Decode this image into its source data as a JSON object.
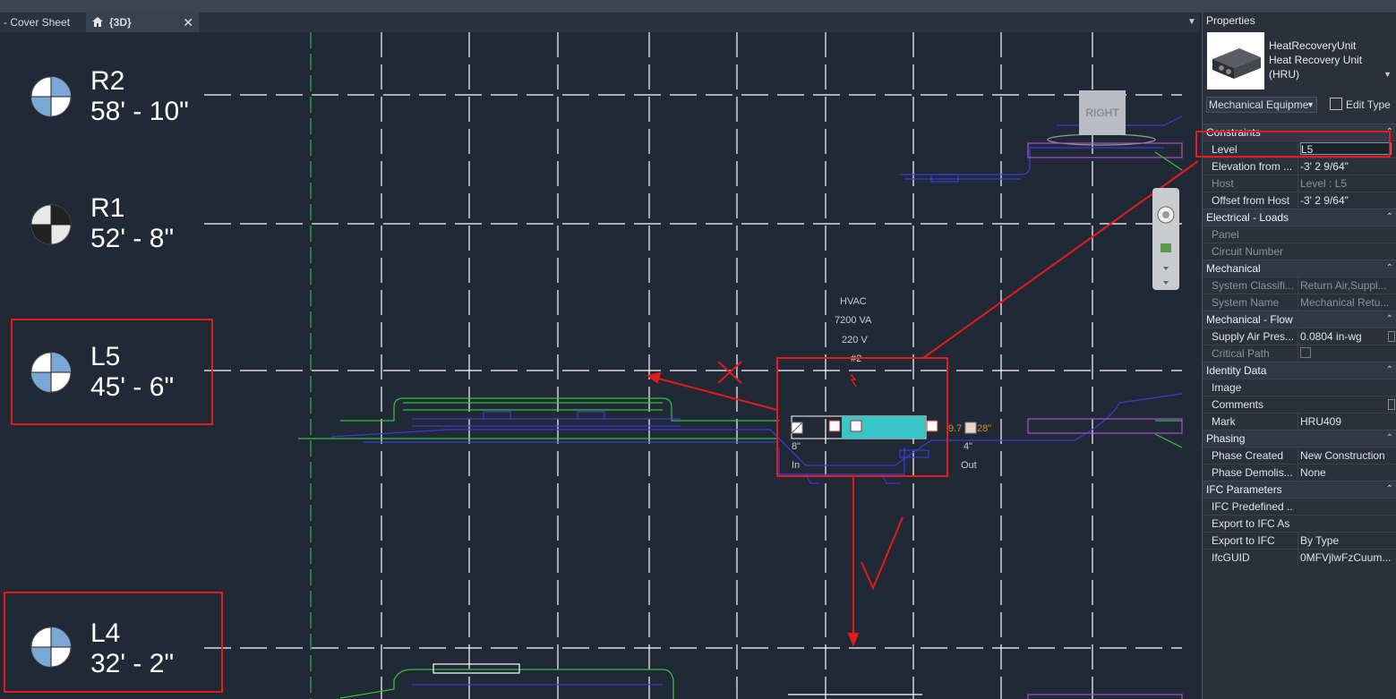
{
  "tabs": {
    "tab1_label": "- Cover Sheet",
    "tab2_label": "{3D}",
    "tab2_close": "✕"
  },
  "viewport": {
    "levels": [
      {
        "name": "R2",
        "elevation": "58' - 10\""
      },
      {
        "name": "R1",
        "elevation": "52' - 8\""
      },
      {
        "name": "L5",
        "elevation": "45' - 6\""
      },
      {
        "name": "L4",
        "elevation": "32' - 2\""
      }
    ],
    "hvac_tag": {
      "line1": "HVAC",
      "line2": "7200 VA",
      "line3": "220 V",
      "line4": "#2"
    },
    "duct_labels": {
      "in_size": "8\"",
      "in": "In",
      "out_size": "4\"",
      "out": "Out",
      "length": "28\"",
      "value_left": "9.7"
    },
    "view_cube_label": "RIGHT"
  },
  "properties": {
    "title": "Properties",
    "type_family": "HeatRecoveryUnit",
    "type_name_line1": "Heat Recovery Unit",
    "type_name_line2": "(HRU)",
    "filter": "Mechanical Equipme",
    "edit_type": "Edit Type",
    "groups": [
      {
        "name": "Constraints",
        "rows": [
          {
            "k": "Level",
            "v": "L5",
            "state": "input"
          },
          {
            "k": "Elevation from ...",
            "v": "-3'  2 9/64\"",
            "state": "normal"
          },
          {
            "k": "Host",
            "v": "Level : L5",
            "state": "dim"
          },
          {
            "k": "Offset from Host",
            "v": "-3'  2 9/64\"",
            "state": "normal"
          }
        ]
      },
      {
        "name": "Electrical - Loads",
        "rows": [
          {
            "k": "Panel",
            "v": "",
            "state": "dim"
          },
          {
            "k": "Circuit Number",
            "v": "",
            "state": "dim"
          }
        ]
      },
      {
        "name": "Mechanical",
        "rows": [
          {
            "k": "System Classifi...",
            "v": "Return Air,Suppl...",
            "state": "dim"
          },
          {
            "k": "System Name",
            "v": "Mechanical Retu...",
            "state": "dim"
          }
        ]
      },
      {
        "name": "Mechanical - Flow",
        "rows": [
          {
            "k": "Supply Air Pres...",
            "v": "0.0804 in-wg",
            "state": "normal",
            "sidebox": true
          },
          {
            "k": "Critical Path",
            "v": "",
            "state": "dim",
            "checkbox": true
          }
        ]
      },
      {
        "name": "Identity Data",
        "rows": [
          {
            "k": "Image",
            "v": "",
            "state": "normal"
          },
          {
            "k": "Comments",
            "v": "",
            "state": "normal",
            "sidebox": true
          },
          {
            "k": "Mark",
            "v": "HRU409",
            "state": "normal"
          }
        ]
      },
      {
        "name": "Phasing",
        "rows": [
          {
            "k": "Phase Created",
            "v": "New Construction",
            "state": "normal"
          },
          {
            "k": "Phase Demolis...",
            "v": "None",
            "state": "normal"
          }
        ]
      },
      {
        "name": "IFC Parameters",
        "rows": [
          {
            "k": "IFC Predefined ...",
            "v": "",
            "state": "normal"
          },
          {
            "k": "Export to IFC As",
            "v": "",
            "state": "normal"
          },
          {
            "k": "Export to IFC",
            "v": "By Type",
            "state": "normal"
          },
          {
            "k": "IfcGUID",
            "v": "0MFVjlwFzCuum...",
            "state": "normal"
          }
        ]
      }
    ]
  }
}
